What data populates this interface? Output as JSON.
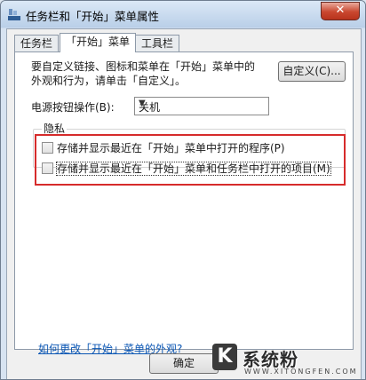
{
  "window": {
    "title": "任务栏和「开始」菜单属性",
    "close_label": "✕"
  },
  "tabs": [
    {
      "label": "任务栏"
    },
    {
      "label": "「开始」菜单"
    },
    {
      "label": "工具栏"
    }
  ],
  "start_menu": {
    "intro_text": "要自定义链接、图标和菜单在「开始」菜单中的外观和行为，请单击「自定义」。",
    "customize_label": "自定义(C)...",
    "power_label": "电源按钮操作(B):",
    "power_value": "关机",
    "privacy_label": "隐私",
    "check_programs": "存储并显示最近在「开始」菜单中打开的程序(P)",
    "check_items": "存储并显示最近在「开始」菜单和任务栏中打开的项目(M)",
    "help_link": "如何更改「开始」菜单的外观?"
  },
  "footer": {
    "ok_label": "确定"
  },
  "watermark": {
    "logo": "K",
    "text": "系统粉",
    "subtext": "WWW.XITONGFEN.COM"
  },
  "colors": {
    "highlight_box": "#d62b2b",
    "link": "#0a56b4"
  },
  "states": {
    "check_programs": false,
    "check_items": false
  },
  "icons": {
    "title_icon": "taskbar-icon",
    "close_icon": "close-icon",
    "dropdown_icon": "chevron-down-icon"
  }
}
